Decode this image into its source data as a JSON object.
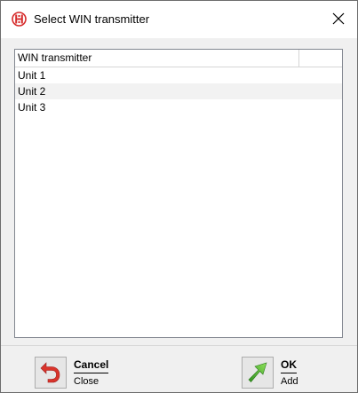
{
  "window": {
    "title": "Select WIN transmitter",
    "icon": "ir-transmitter-icon",
    "close_icon": "close-icon"
  },
  "list": {
    "columns": [
      "WIN transmitter",
      ""
    ],
    "rows": [
      "Unit 1",
      "Unit 2",
      "Unit 3"
    ]
  },
  "actions": {
    "cancel": {
      "title": "Cancel",
      "subtitle": "Close",
      "icon": "undo-arrow-icon"
    },
    "ok": {
      "title": "OK",
      "subtitle": "Add",
      "icon": "green-arrow-icon"
    }
  },
  "colors": {
    "app_icon_red": "#d62b2b",
    "cancel_red": "#d9342b",
    "ok_green": "#4caf2a"
  }
}
